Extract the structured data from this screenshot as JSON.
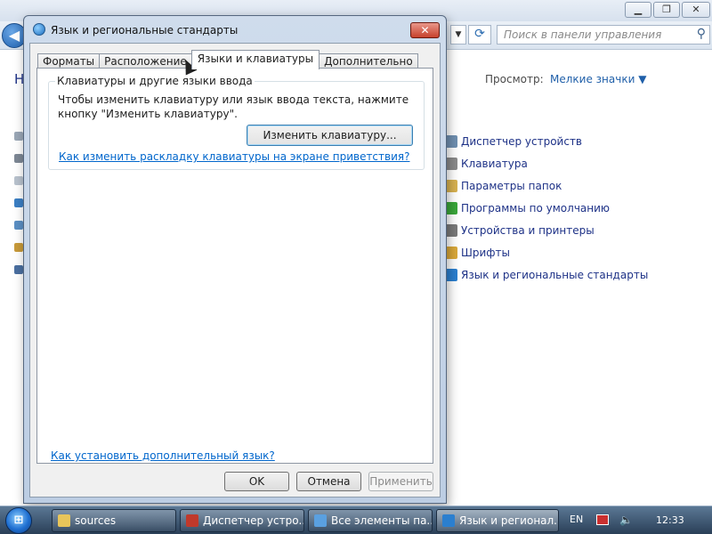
{
  "colors": {
    "link": "#0066cc",
    "cp_item": "#1e3287",
    "dialog_frame": "#cfdcec",
    "close_red": "#c7412c",
    "taskbar": "#2a3f57"
  },
  "control_panel": {
    "search_placeholder": "Поиск в панели управления",
    "heading_partial": "Н",
    "view_label": "Просмотр:",
    "view_value": "Мелкие значки",
    "view_arrow_icon": "▼",
    "items": [
      {
        "label": "Диспетчер устройств",
        "icon": "device-manager-icon",
        "color": "#6f8fb0"
      },
      {
        "label": "Клавиатура",
        "icon": "keyboard-icon",
        "color": "#8a8a8a"
      },
      {
        "label": "Параметры папок",
        "icon": "folder-options-icon",
        "color": "#d7b150"
      },
      {
        "label": "Программы по умолчанию",
        "icon": "default-programs-icon",
        "color": "#3aa63a"
      },
      {
        "label": "Устройства и принтеры",
        "icon": "printer-icon",
        "color": "#7a7a7a"
      },
      {
        "label": "Шрифты",
        "icon": "fonts-icon",
        "color": "#d9a83a"
      },
      {
        "label": "Язык и региональные стандарты",
        "icon": "region-language-icon",
        "color": "#2b7fcf"
      }
    ]
  },
  "dialog": {
    "title": "Язык и региональные стандарты",
    "close_glyph": "✕",
    "tabs": [
      {
        "label": "Форматы",
        "active": false
      },
      {
        "label": "Расположение",
        "active": false
      },
      {
        "label": "Языки и клавиатуры",
        "active": true
      },
      {
        "label": "Дополнительно",
        "active": false
      }
    ],
    "group_title": "Клавиатуры и другие языки ввода",
    "group_description": "Чтобы изменить клавиатуру или язык ввода текста, нажмите кнопку \"Изменить клавиатуру\".",
    "change_keyboard_button": "Изменить клавиатуру...",
    "welcome_screen_link": "Как изменить раскладку клавиатуры на экране приветствия?",
    "add_language_link": "Как установить дополнительный язык?",
    "ok_button": "OK",
    "cancel_button": "Отмена",
    "apply_button": "Применить"
  },
  "taskbar": {
    "start_glyph": "⊞",
    "buttons": [
      {
        "label": "sources",
        "icon": "folder-icon",
        "color": "#e8c55a",
        "active": false
      },
      {
        "label": "Диспетчер устро...",
        "icon": "device-manager-icon",
        "color": "#c0392b",
        "active": false
      },
      {
        "label": "Все элементы па...",
        "icon": "control-panel-icon",
        "color": "#5aa0e0",
        "active": false
      },
      {
        "label": "Язык и регионал...",
        "icon": "region-language-icon",
        "color": "#2b7fcf",
        "active": true
      }
    ],
    "language": "EN",
    "volume_glyph": "🔈",
    "clock": "12:33"
  }
}
